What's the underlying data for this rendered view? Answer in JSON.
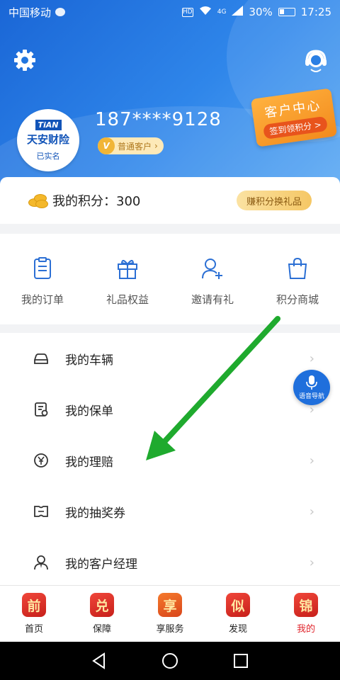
{
  "statusbar": {
    "carrier": "中国移动",
    "battery": "30%",
    "time": "17:25",
    "network": "4G",
    "hd": "HD"
  },
  "header": {
    "phone": "187****9128",
    "level": "普通客户",
    "level_mark": "V",
    "avatar_logo_top": "TiAN",
    "avatar_logo_main": "天安财险",
    "verified": "已实名"
  },
  "customer_service": {
    "title": "客户中心",
    "action": "签到领积分 >"
  },
  "points": {
    "label": "我的积分：300",
    "redeem": "赚积分换礼品"
  },
  "quick_actions": [
    {
      "label": "我的订单",
      "icon": "order-icon"
    },
    {
      "label": "礼品权益",
      "icon": "gift-icon"
    },
    {
      "label": "邀请有礼",
      "icon": "invite-icon"
    },
    {
      "label": "积分商城",
      "icon": "shop-bag-icon"
    }
  ],
  "menu": [
    {
      "label": "我的车辆",
      "icon": "car-icon"
    },
    {
      "label": "我的保单",
      "icon": "policy-icon"
    },
    {
      "label": "我的理赔",
      "icon": "claim-yen-icon"
    },
    {
      "label": "我的抽奖券",
      "icon": "ticket-icon"
    },
    {
      "label": "我的客户经理",
      "icon": "manager-icon"
    }
  ],
  "voice_nav": "语音导航",
  "tabs": [
    {
      "label": "首页",
      "glyph": "前"
    },
    {
      "label": "保障",
      "glyph": "兑"
    },
    {
      "label": "享服务",
      "glyph": "享"
    },
    {
      "label": "发现",
      "glyph": "似"
    },
    {
      "label": "我的",
      "glyph": "锦",
      "active": true
    }
  ],
  "colors": {
    "header_blue": "#1a66d6",
    "accent_orange": "#f28a1c",
    "tab_active_red": "#e0262d",
    "arrow_green": "#1faa2e"
  }
}
